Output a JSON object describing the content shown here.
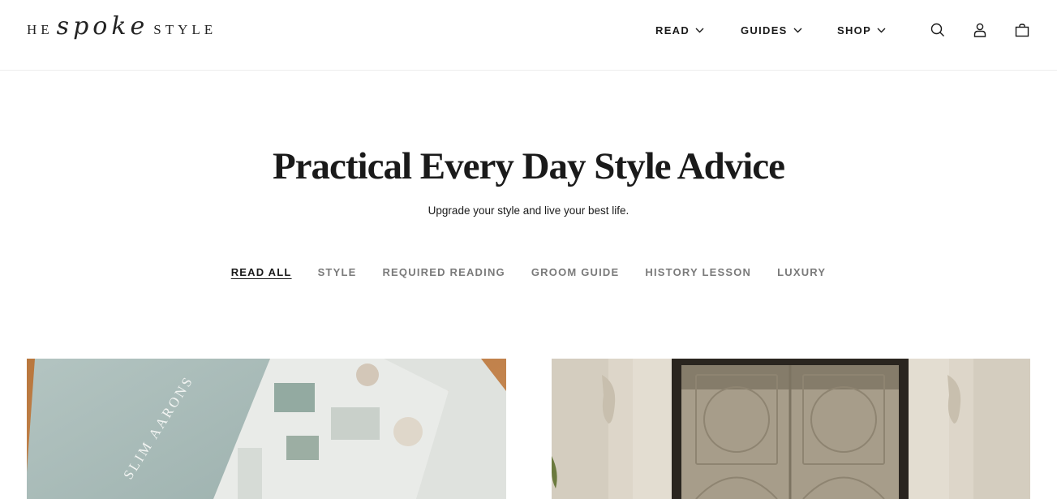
{
  "logo": {
    "prefix": "HE",
    "script": "spoke",
    "suffix": "STYLE"
  },
  "nav": {
    "items": [
      {
        "label": "READ"
      },
      {
        "label": "GUIDES"
      },
      {
        "label": "SHOP"
      }
    ],
    "icons": [
      "search-icon",
      "account-icon",
      "shopping-bag-icon"
    ]
  },
  "hero": {
    "title": "Practical Every Day Style Advice",
    "subtitle": "Upgrade your style and live your best life."
  },
  "tabs": [
    {
      "label": "READ ALL",
      "active": true
    },
    {
      "label": "STYLE",
      "active": false
    },
    {
      "label": "REQUIRED READING",
      "active": false
    },
    {
      "label": "GROOM GUIDE",
      "active": false
    },
    {
      "label": "HISTORY LESSON",
      "active": false
    },
    {
      "label": "LUXURY",
      "active": false
    }
  ],
  "cards": [
    {
      "book_text": "SLIM AARONS"
    },
    {}
  ],
  "colors": {
    "text": "#1a1a1a",
    "muted": "#7a7a7a",
    "border": "#ececec"
  }
}
